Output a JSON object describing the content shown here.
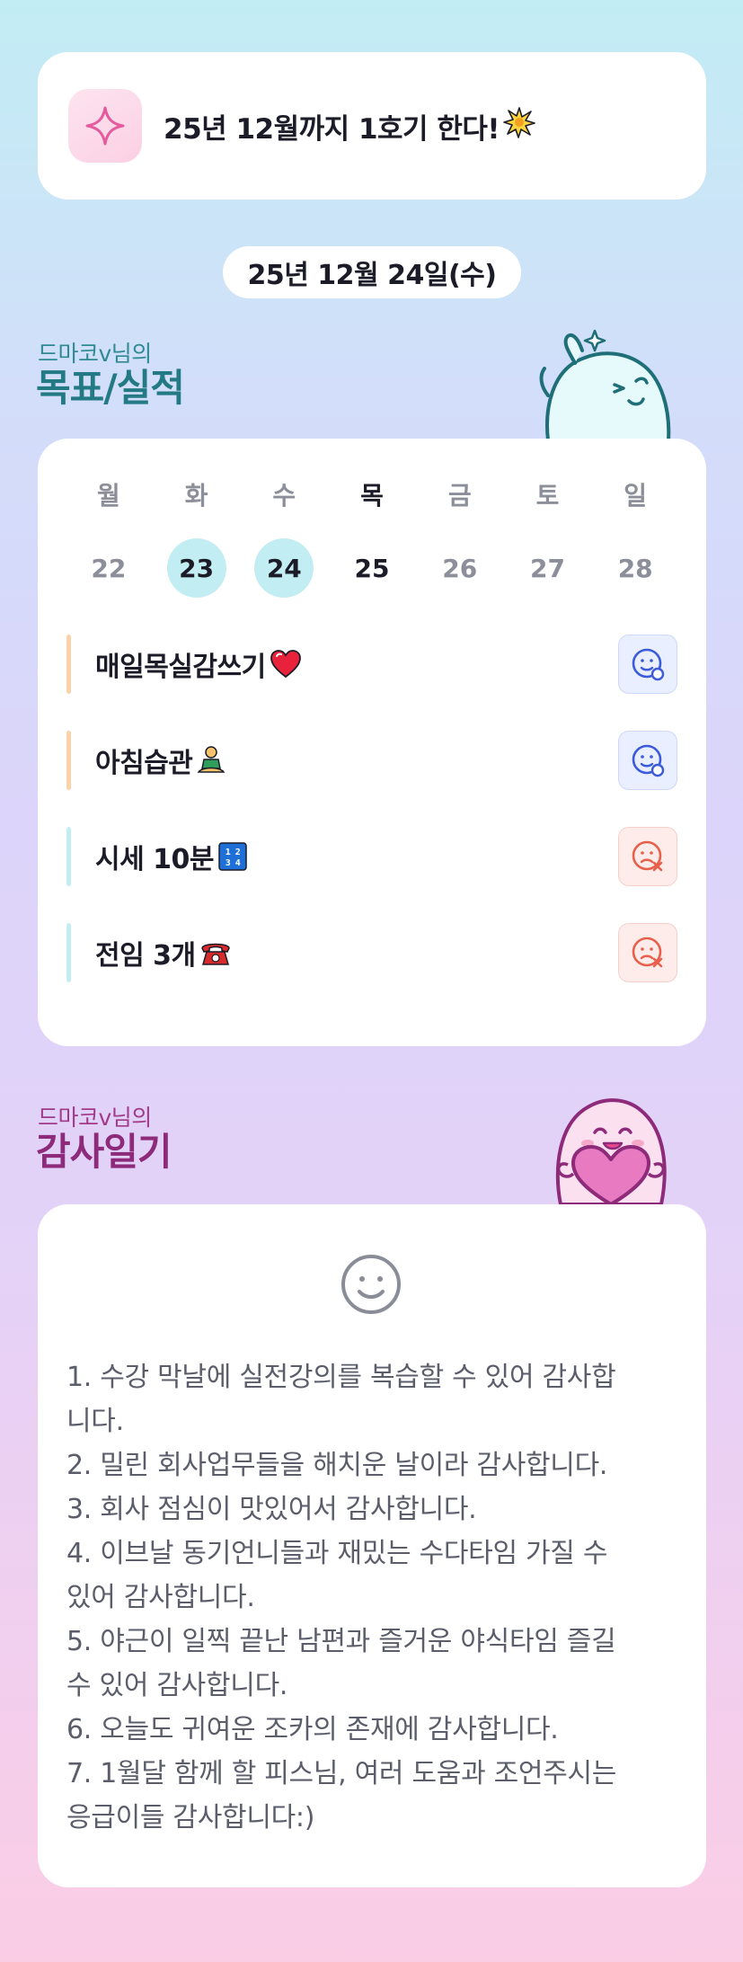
{
  "goal_banner": {
    "text": "25년 12월까지 1호기 한다!",
    "icon": "sparkle-icon",
    "trailing_emoji": "sparkle-star-emoji"
  },
  "date_pill": "25년 12월 24일(수)",
  "goals_section": {
    "subtitle": "드마코v님의",
    "title": "목표/실적"
  },
  "week": {
    "days": [
      "월",
      "화",
      "수",
      "목",
      "금",
      "토",
      "일"
    ],
    "dates": [
      "22",
      "23",
      "24",
      "25",
      "26",
      "27",
      "28"
    ],
    "completed": [
      false,
      true,
      true,
      false,
      false,
      false,
      false
    ],
    "today_index": 3
  },
  "goals": [
    {
      "label": "매일목실감쓰기",
      "emoji": "heart-emoji",
      "bar_color": "#fcd2a8",
      "status": "done",
      "status_icon": "smile-check-icon"
    },
    {
      "label": "아침습관",
      "emoji": "meditating-person-emoji",
      "bar_color": "#fcd2a8",
      "status": "done",
      "status_icon": "smile-check-icon"
    },
    {
      "label": "시세 10분",
      "emoji": "numbers-1234-emoji",
      "bar_color": "#c2eef3",
      "status": "missed",
      "status_icon": "sad-x-icon"
    },
    {
      "label": "전임 3개",
      "emoji": "telephone-emoji",
      "bar_color": "#c2eef3",
      "status": "missed",
      "status_icon": "sad-x-icon"
    }
  ],
  "thanks_section": {
    "subtitle": "드마코v님의",
    "title": "감사일기",
    "mood_icon": "smile-face-icon",
    "lines": [
      "1. 수강 막날에 실전강의를 복습할 수 있어 감사합",
      "니다.",
      "2. 밀린 회사업무들을 해치운 날이라 감사합니다.",
      "3. 회사 점심이 맛있어서 감사합니다.",
      "4. 이브날 동기언니들과 재밌는 수다타임 가질 수",
      "있어 감사합니다.",
      "5. 야근이 일찍 끝난 남편과 즐거운 야식타임 즐길",
      "수 있어 감사합니다.",
      "6. 오늘도 귀여운 조카의 존재에 감사합니다.",
      "7. 1월달 함께 할 피스님, 여러 도움과 조언주시는",
      "응급이들 감사합니다:)"
    ]
  },
  "colors": {
    "accent_teal": "#237a85",
    "accent_magenta": "#8e2a7a",
    "done_blue": "#3b5bdb",
    "missed_red": "#e8604c"
  }
}
